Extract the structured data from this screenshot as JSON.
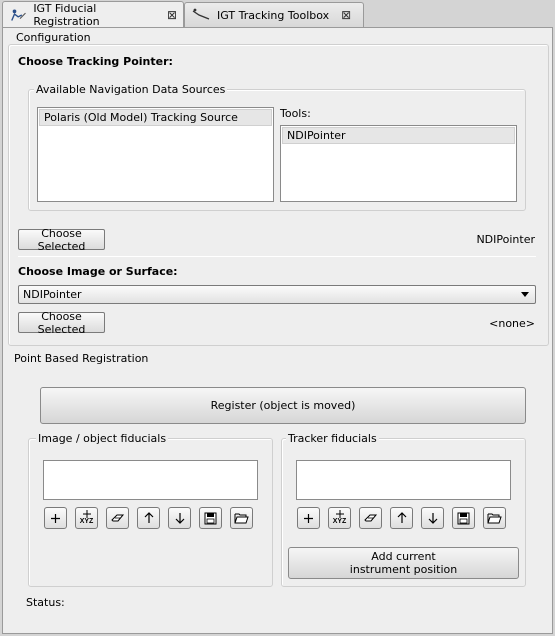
{
  "tabs": [
    {
      "label": "IGT Fiducial Registration",
      "close": "⊠"
    },
    {
      "label": "IGT Tracking Toolbox",
      "close": "⊠"
    }
  ],
  "configuration": {
    "title": "Configuration",
    "choose_pointer": "Choose Tracking Pointer:",
    "sources_title": "Available Navigation Data Sources",
    "sources": [
      "Polaris (Old Model) Tracking Source"
    ],
    "tools_label": "Tools:",
    "tools": [
      "NDIPointer"
    ],
    "choose_selected_1": "Choose Selected",
    "selected_pointer": "NDIPointer",
    "choose_image": "Choose Image or Surface:",
    "image_combo_value": "NDIPointer",
    "choose_selected_2": "Choose Selected",
    "selected_image": "<none>"
  },
  "registration": {
    "title": "Point Based Registration",
    "register_button": "Register (object is moved)",
    "image_fiducials_title": "Image / object fiducials",
    "tracker_fiducials_title": "Tracker fiducials",
    "add_current_line1": "Add current",
    "add_current_line2": "instrument position",
    "status_label": "Status:",
    "xyz_label": "XYZ"
  }
}
